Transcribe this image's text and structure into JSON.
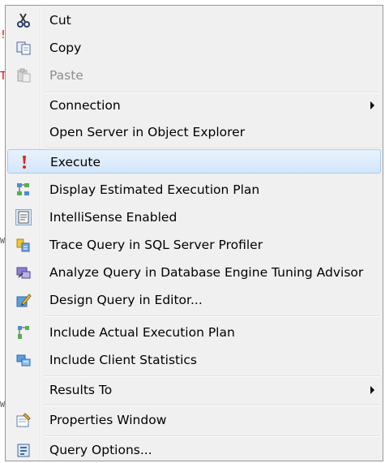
{
  "editor_bleed": {
    "top": "!",
    "mid": "T",
    "w1": "W",
    "w2": "W"
  },
  "menu": {
    "cut": "Cut",
    "copy": "Copy",
    "paste": "Paste",
    "connection": "Connection",
    "open_server": "Open Server in Object Explorer",
    "execute": "Execute",
    "display_plan": "Display Estimated Execution Plan",
    "intellisense": "IntelliSense Enabled",
    "trace": "Trace Query in SQL Server Profiler",
    "analyze": "Analyze Query in Database Engine Tuning Advisor",
    "design": "Design Query in Editor...",
    "include_plan": "Include Actual Execution Plan",
    "client_stats": "Include Client Statistics",
    "results_to": "Results To",
    "properties": "Properties Window",
    "query_options": "Query Options..."
  },
  "state": {
    "highlighted_item": "execute",
    "intellisense_checked": true
  }
}
